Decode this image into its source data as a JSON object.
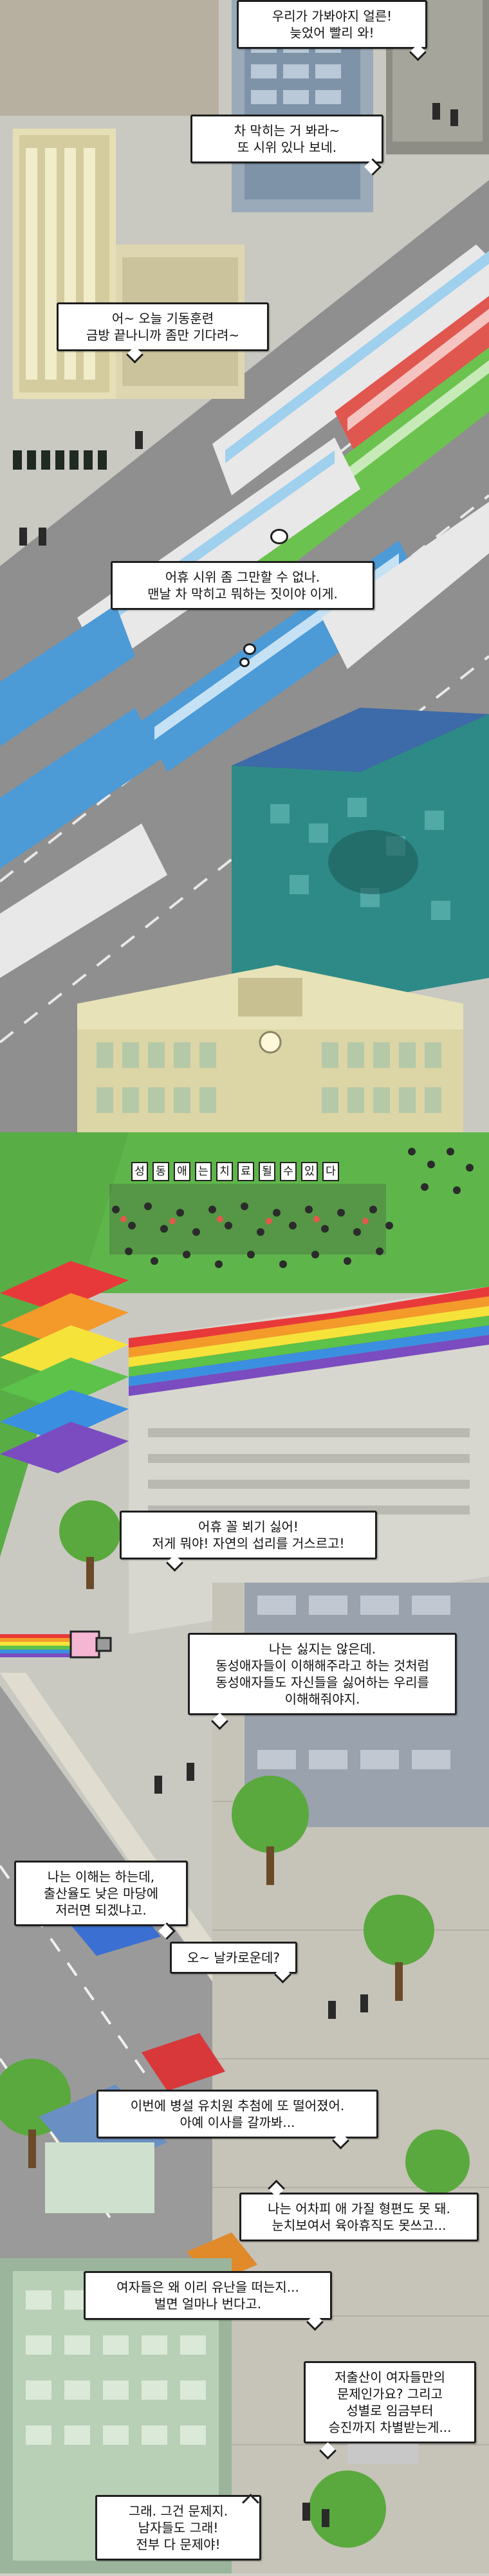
{
  "bubbles": [
    {
      "id": "b1",
      "lines": [
        "우리가 가봐야지 얼른!",
        "늦었어 빨리 와!"
      ]
    },
    {
      "id": "b2",
      "lines": [
        "차 막히는 거 봐라~",
        "또 시위 있나 보네."
      ]
    },
    {
      "id": "b3",
      "lines": [
        "어~ 오늘 기동훈련",
        "금방 끝나니까 좀만 기다려~"
      ]
    },
    {
      "id": "b4",
      "lines": [
        "어휴 시위 좀 그만할 수 없나.",
        "맨날 차 막히고 뭐하는 짓이야 이게."
      ]
    },
    {
      "id": "b5",
      "lines": [
        "어휴 꼴 뵈기 싫어!",
        "저게 뭐야! 자연의 섭리를 거스르고!"
      ]
    },
    {
      "id": "b6",
      "lines": [
        "나는 싫지는 않은데.",
        "동성애자들이 이해해주라고 하는 것처럼",
        "동성애자들도 자신들을 싫어하는 우리를",
        "이해해줘야지."
      ]
    },
    {
      "id": "b7",
      "lines": [
        "나는 이해는 하는데,",
        "출산율도 낮은 마당에",
        "저러면 되겠냐고."
      ]
    },
    {
      "id": "b8",
      "lines": [
        "오~ 날카로운데?"
      ]
    },
    {
      "id": "b9",
      "lines": [
        "이번에 병설 유치원 추첨에 또 떨어졌어.",
        "아예 이사를 갈까봐..."
      ]
    },
    {
      "id": "b10",
      "lines": [
        "나는 어차피 애 가질 형편도 못 돼.",
        "눈치보여서 육아휴직도 못쓰고..."
      ]
    },
    {
      "id": "b11",
      "lines": [
        "여자들은 왜 이리 유난을 떠는지...",
        "벌면 얼마나 번다고."
      ]
    },
    {
      "id": "b12",
      "lines": [
        "저출산이 여자들만의",
        "문제인가요? 그리고",
        "성별로 임금부터",
        "승진까지 차별받는게..."
      ]
    },
    {
      "id": "b13",
      "lines": [
        "그래. 그건 문제지.",
        "남자들도 그래!",
        "전부 다 문제야!"
      ]
    }
  ],
  "protest_banner": [
    "성",
    "동",
    "애",
    "는",
    "치",
    "료",
    "될",
    "수",
    "있",
    "다"
  ],
  "colors": {
    "road": "#8c8c8c",
    "rainbow": [
      "#e8393a",
      "#f39a2b",
      "#f6e33a",
      "#5cc24a",
      "#3b8fe0",
      "#7a4cc0"
    ],
    "grass": "#5eb64a",
    "glass_building": "#2e8a86"
  }
}
